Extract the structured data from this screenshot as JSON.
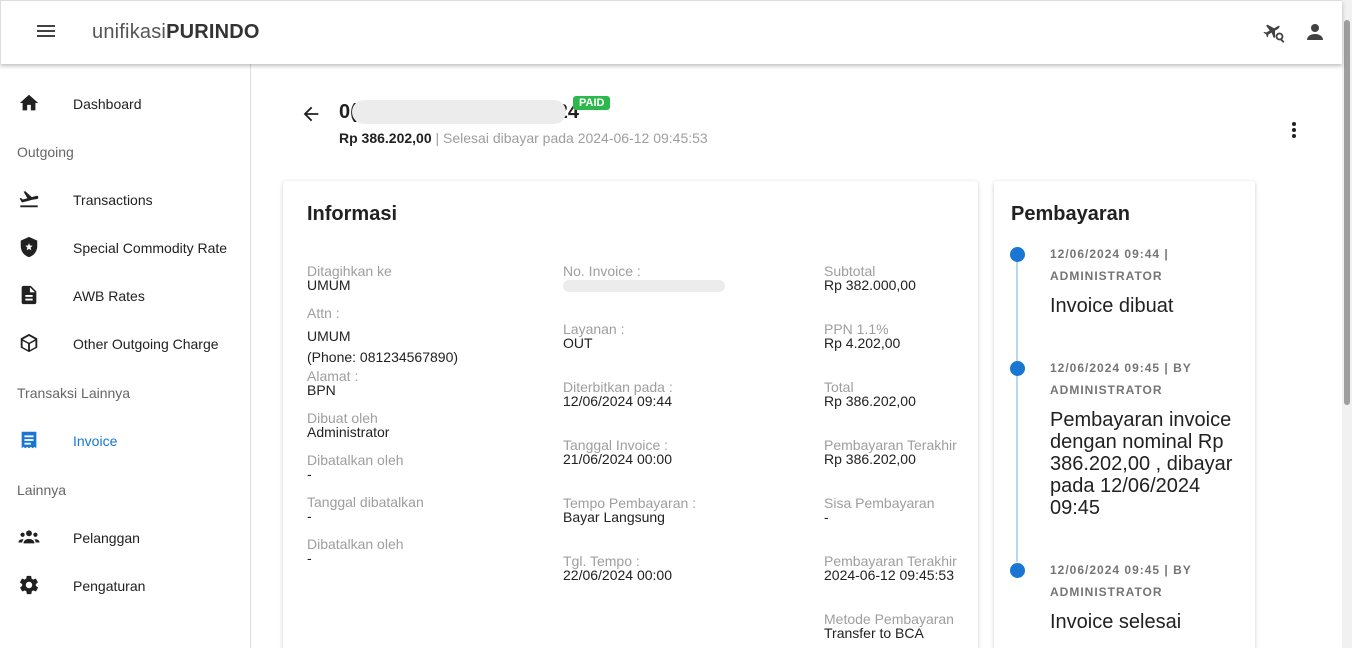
{
  "app": {
    "brand_light": "unifikasi",
    "brand_bold": "PURINDO"
  },
  "topbar_icons": [
    "menu-icon",
    "flight-search-icon",
    "account-icon"
  ],
  "sidebar": {
    "items": [
      {
        "label": "Dashboard",
        "icon": "home-icon"
      },
      {
        "section": "Outgoing"
      },
      {
        "label": "Transactions",
        "icon": "flight-takeoff-icon"
      },
      {
        "label": "Special Commodity Rate",
        "icon": "shield-icon"
      },
      {
        "label": "AWB Rates",
        "icon": "document-icon"
      },
      {
        "label": "Other Outgoing Charge",
        "icon": "package-icon"
      },
      {
        "section": "Transaksi Lainnya"
      },
      {
        "label": "Invoice",
        "icon": "receipt-icon",
        "active": true
      },
      {
        "section": "Lainnya"
      },
      {
        "label": "Pelanggan",
        "icon": "people-icon"
      },
      {
        "label": "Pengaturan",
        "icon": "gear-icon"
      }
    ]
  },
  "header": {
    "invoice_prefix": "0(",
    "invoice_suffix": "24",
    "status": "PAID",
    "amount": "Rp 386.202,00",
    "paid_note": " | Selesai dibayar pada 2024-06-12 09:45:53"
  },
  "info": {
    "title": "Informasi",
    "col1": {
      "ditagihkan_ke": {
        "label": "Ditagihkan ke",
        "value": "UMUM"
      },
      "attn": {
        "label": "Attn :",
        "name": "UMUM",
        "phone": "(Phone: 081234567890)"
      },
      "alamat": {
        "label": "Alamat :",
        "value": "BPN"
      },
      "dibuat_oleh": {
        "label": "Dibuat oleh",
        "value": "Administrator"
      },
      "dibatalkan_oleh": {
        "label": "Dibatalkan oleh",
        "value": "-"
      },
      "tanggal_dibatalkan": {
        "label": "Tanggal dibatalkan",
        "value": "-"
      },
      "dibatalkan_oleh_2": {
        "label": "Dibatalkan oleh",
        "value": "-"
      }
    },
    "col2": {
      "no_invoice": {
        "label": "No. Invoice :"
      },
      "layanan": {
        "label": "Layanan :",
        "value": "OUT"
      },
      "diterbitkan": {
        "label": "Diterbitkan pada :",
        "value": "12/06/2024 09:44"
      },
      "tanggal_invoice": {
        "label": "Tanggal Invoice :",
        "value": "21/06/2024 00:00"
      },
      "tempo": {
        "label": "Tempo Pembayaran :",
        "value": "Bayar Langsung"
      },
      "tgl_tempo": {
        "label": "Tgl. Tempo :",
        "value": "22/06/2024 00:00"
      }
    },
    "col3": {
      "subtotal": {
        "label": "Subtotal",
        "value": "Rp 382.000,00"
      },
      "ppn": {
        "label": "PPN 1.1%",
        "value": "Rp 4.202,00"
      },
      "total": {
        "label": "Total",
        "value": "Rp 386.202,00"
      },
      "pembayaran_terakhir": {
        "label": "Pembayaran Terakhir",
        "value": "Rp 386.202,00"
      },
      "sisa": {
        "label": "Sisa Pembayaran",
        "value": "-"
      },
      "pembayaran_terakhir_2": {
        "label": "Pembayaran Terakhir",
        "value": "2024-06-12 09:45:53"
      },
      "metode": {
        "label": "Metode Pembayaran",
        "value": "Transfer to BCA"
      }
    }
  },
  "payment": {
    "title": "Pembayaran",
    "timeline": [
      {
        "meta": "12/06/2024 09:44 | ADMINISTRATOR",
        "text": "Invoice dibuat"
      },
      {
        "meta": "12/06/2024 09:45 | BY ADMINISTRATOR",
        "text": "Pembayaran invoice dengan nominal Rp 386.202,00 , dibayar pada 12/06/2024 09:45"
      },
      {
        "meta": "12/06/2024 09:45 | BY ADMINISTRATOR",
        "text": "Invoice selesai"
      }
    ]
  },
  "colors": {
    "accent": "#1976d2",
    "paid": "#2db84b",
    "timeline_line": "#b9d6ee"
  }
}
